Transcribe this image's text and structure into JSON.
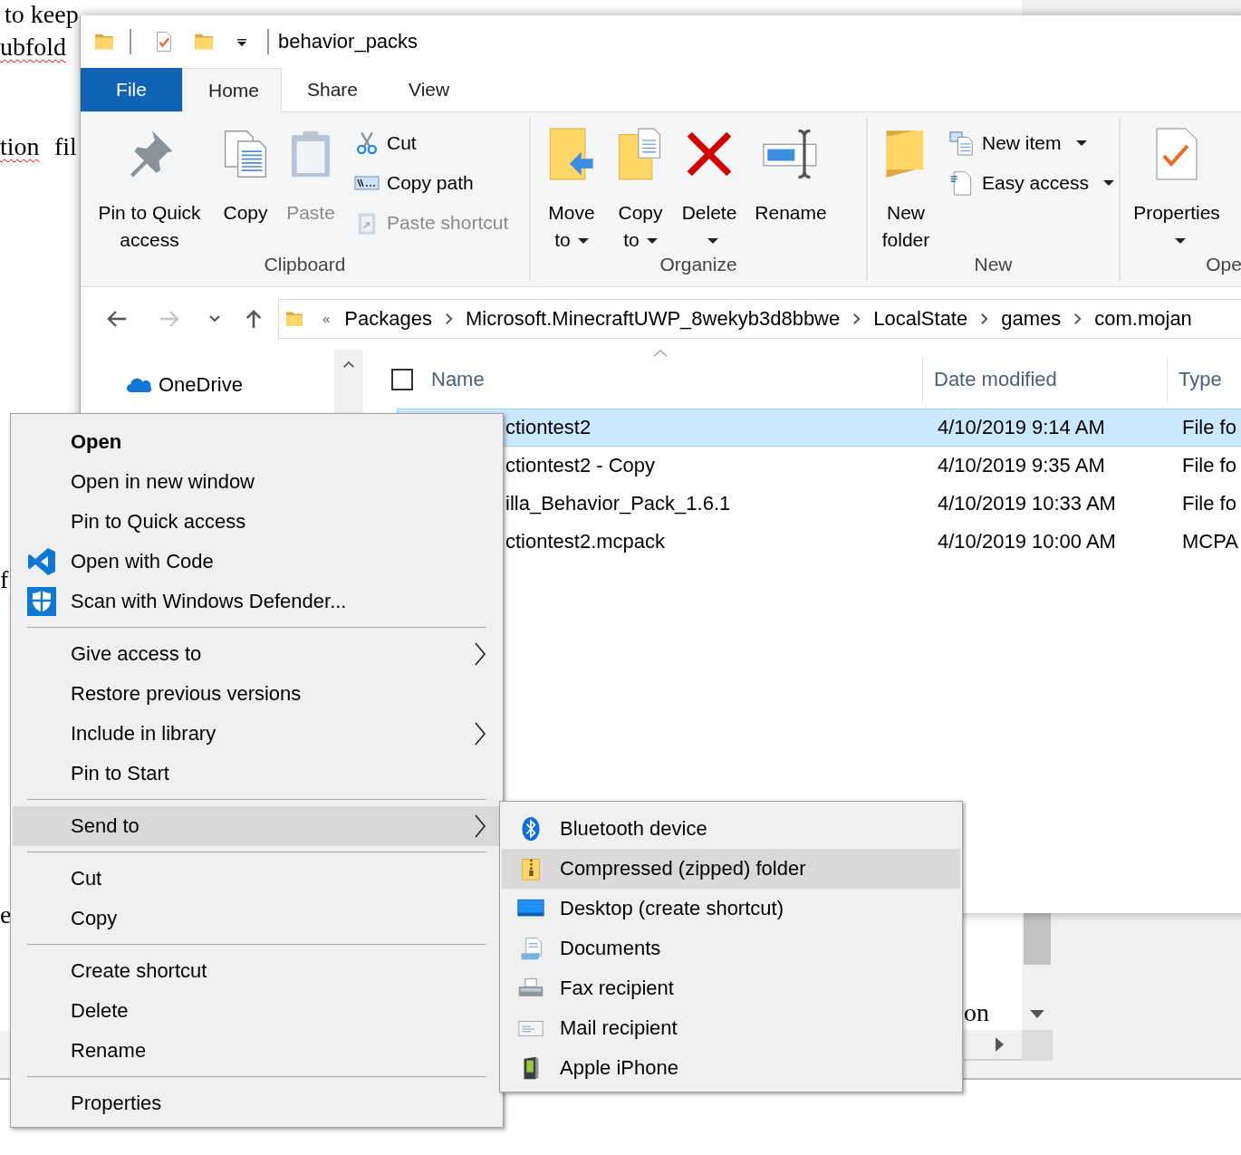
{
  "document": {
    "fragments": [
      {
        "text": "to keep",
        "misspelled": false
      },
      {
        "text": "ubfold",
        "misspelled": true
      },
      {
        "text": "tion",
        "misspelled": true
      },
      {
        "text": "fil",
        "misspelled": false
      },
      {
        "text": "f",
        "misspelled": false
      },
      {
        "text": "e",
        "misspelled": false
      },
      {
        "text": "on",
        "misspelled": false
      }
    ]
  },
  "explorer": {
    "title": "behavior_packs",
    "tabs": [
      {
        "label": "File",
        "kind": "file",
        "selected": false
      },
      {
        "label": "Home",
        "kind": "tab",
        "selected": true
      },
      {
        "label": "Share",
        "kind": "tab",
        "selected": false
      },
      {
        "label": "View",
        "kind": "tab",
        "selected": false
      }
    ],
    "ribbon": {
      "groups": [
        {
          "label": "Clipboard",
          "large": [
            {
              "label": "Pin to Quick access",
              "disabled": false,
              "dropdown": false
            },
            {
              "label": "Copy",
              "disabled": false,
              "dropdown": false
            },
            {
              "label": "Paste",
              "disabled": true,
              "dropdown": false
            }
          ],
          "small": [
            {
              "label": "Cut",
              "disabled": false,
              "dropdown": false
            },
            {
              "label": "Copy path",
              "disabled": false,
              "dropdown": false
            },
            {
              "label": "Paste shortcut",
              "disabled": true,
              "dropdown": false
            }
          ]
        },
        {
          "label": "Organize",
          "large": [
            {
              "label": "Move to",
              "disabled": false,
              "dropdown": true
            },
            {
              "label": "Copy to",
              "disabled": false,
              "dropdown": true
            },
            {
              "label": "Delete",
              "disabled": false,
              "dropdown": true
            },
            {
              "label": "Rename",
              "disabled": false,
              "dropdown": false
            }
          ]
        },
        {
          "label": "New",
          "large": [
            {
              "label": "New folder",
              "disabled": false,
              "dropdown": false
            }
          ],
          "small": [
            {
              "label": "New item",
              "disabled": false,
              "dropdown": true
            },
            {
              "label": "Easy access",
              "disabled": false,
              "dropdown": true
            }
          ]
        },
        {
          "label": "Ope",
          "large": [
            {
              "label": "Properties",
              "disabled": false,
              "dropdown": true
            }
          ]
        }
      ]
    },
    "nav": {
      "back_disabled": false,
      "forward_disabled": true
    },
    "address": {
      "overflow": "«",
      "crumbs": [
        "Packages",
        "Microsoft.MinecraftUWP_8wekyb3d8bbwe",
        "LocalState",
        "games",
        "com.mojan"
      ]
    },
    "nav_pane": {
      "items": [
        {
          "label": "OneDrive"
        }
      ]
    },
    "file_list": {
      "columns": [
        "Name",
        "Date modified",
        "Type"
      ],
      "select_all_checked": false,
      "rows": [
        {
          "name": "ctiontest2",
          "date": "4/10/2019 9:14 AM",
          "type": "File fo",
          "selected": true
        },
        {
          "name": "ctiontest2 - Copy",
          "date": "4/10/2019 9:35 AM",
          "type": "File fo",
          "selected": false
        },
        {
          "name": "illa_Behavior_Pack_1.6.1",
          "date": "4/10/2019 10:33 AM",
          "type": "File fo",
          "selected": false
        },
        {
          "name": "ctiontest2.mcpack",
          "date": "4/10/2019 10:00 AM",
          "type": "MCPA",
          "selected": false
        }
      ]
    }
  },
  "context_menu": {
    "items": [
      {
        "kind": "item",
        "label": "Open",
        "default": true,
        "submenu": false,
        "selected": false
      },
      {
        "kind": "item",
        "label": "Open in new window",
        "default": false,
        "submenu": false,
        "selected": false
      },
      {
        "kind": "item",
        "label": "Pin to Quick access",
        "default": false,
        "submenu": false,
        "selected": false
      },
      {
        "kind": "item",
        "label": "Open with Code",
        "default": false,
        "submenu": false,
        "selected": false
      },
      {
        "kind": "item",
        "label": "Scan with Windows Defender...",
        "default": false,
        "submenu": false,
        "selected": false
      },
      {
        "kind": "separator"
      },
      {
        "kind": "item",
        "label": "Give access to",
        "default": false,
        "submenu": true,
        "selected": false
      },
      {
        "kind": "item",
        "label": "Restore previous versions",
        "default": false,
        "submenu": false,
        "selected": false
      },
      {
        "kind": "item",
        "label": "Include in library",
        "default": false,
        "submenu": true,
        "selected": false
      },
      {
        "kind": "item",
        "label": "Pin to Start",
        "default": false,
        "submenu": false,
        "selected": false
      },
      {
        "kind": "separator"
      },
      {
        "kind": "item",
        "label": "Send to",
        "default": false,
        "submenu": true,
        "selected": true
      },
      {
        "kind": "separator"
      },
      {
        "kind": "item",
        "label": "Cut",
        "default": false,
        "submenu": false,
        "selected": false
      },
      {
        "kind": "item",
        "label": "Copy",
        "default": false,
        "submenu": false,
        "selected": false
      },
      {
        "kind": "separator"
      },
      {
        "kind": "item",
        "label": "Create shortcut",
        "default": false,
        "submenu": false,
        "selected": false
      },
      {
        "kind": "item",
        "label": "Delete",
        "default": false,
        "submenu": false,
        "selected": false
      },
      {
        "kind": "item",
        "label": "Rename",
        "default": false,
        "submenu": false,
        "selected": false
      },
      {
        "kind": "separator"
      },
      {
        "kind": "item",
        "label": "Properties",
        "default": false,
        "submenu": false,
        "selected": false
      }
    ]
  },
  "send_to_menu": {
    "items": [
      {
        "label": "Bluetooth device",
        "selected": false
      },
      {
        "label": "Compressed (zipped) folder",
        "selected": true
      },
      {
        "label": "Desktop (create shortcut)",
        "selected": false
      },
      {
        "label": "Documents",
        "selected": false
      },
      {
        "label": "Fax recipient",
        "selected": false
      },
      {
        "label": "Mail recipient",
        "selected": false
      },
      {
        "label": "Apple iPhone",
        "selected": false
      }
    ]
  }
}
